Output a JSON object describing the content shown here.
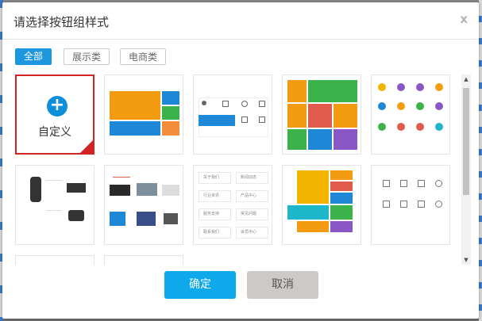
{
  "dialog": {
    "title": "请选择按钮组样式",
    "close_label": "x"
  },
  "tabs": [
    {
      "label": "全部",
      "active": true
    },
    {
      "label": "展示类",
      "active": false
    },
    {
      "label": "电商类",
      "active": false
    }
  ],
  "custom_card": {
    "label": "自定义"
  },
  "buttons": {
    "ok": "确定",
    "cancel": "取消"
  },
  "card3_labels": [
    "关于我们",
    "新闻动态",
    "行业资讯",
    "产品中心",
    "服务支持",
    "常见问题",
    "联系我们",
    "会员中心"
  ],
  "colors": {
    "accent": "#1d97de",
    "ok_button": "#0da9ea",
    "cancel_button": "#ccc9c6",
    "custom_border": "#d22424"
  }
}
